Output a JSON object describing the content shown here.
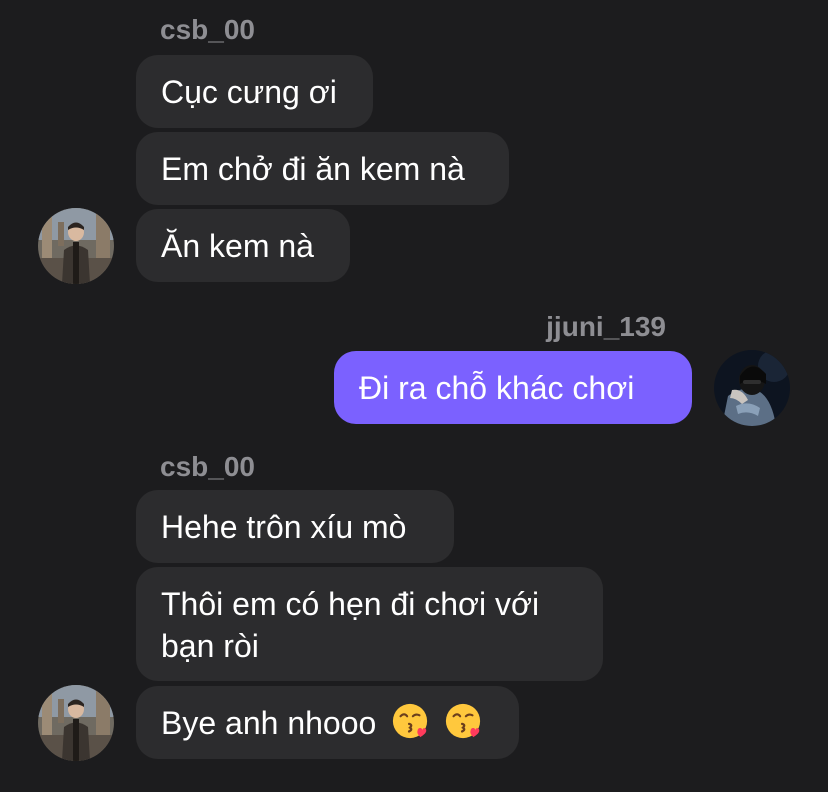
{
  "conversation": [
    {
      "sender": "csb_00",
      "messages": [
        "Cục cưng ơi",
        "Em chở đi ăn kem nà",
        "Ăn kem nà"
      ],
      "avatar_icon": "user-avatar-photo"
    },
    {
      "sender": "jjuni_139",
      "messages": [
        "Đi ra chỗ khác chơi"
      ],
      "avatar_icon": "user-avatar-photo",
      "bubble_color": "#7b61ff"
    },
    {
      "sender": "csb_00",
      "messages": [
        "Hehe trôn xíu mò",
        "Thôi em có hẹn đi chơi với bạn ròi",
        "Bye anh nhooo"
      ],
      "emoji": [
        "kissing-face-with-heart",
        "kissing-face-with-heart"
      ],
      "avatar_icon": "user-avatar-photo"
    }
  ],
  "colors": {
    "background": "#1c1c1e",
    "incoming_bubble": "#2c2c2e",
    "outgoing_bubble": "#7b61ff",
    "sender_name": "#8e8e93"
  }
}
